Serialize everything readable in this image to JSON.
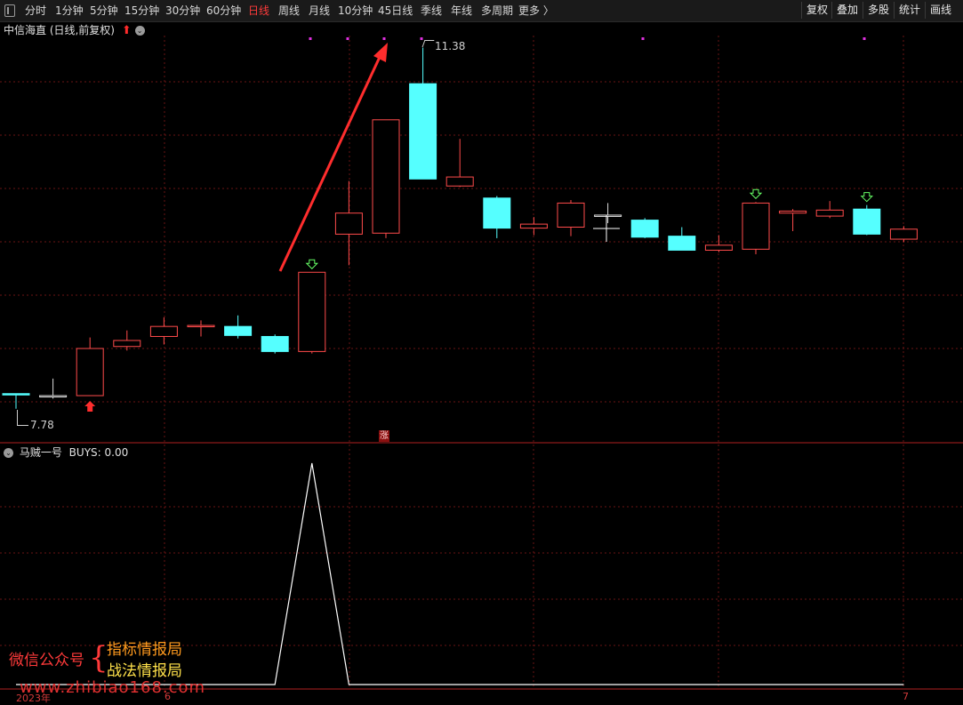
{
  "toolbar": {
    "periods": [
      "分时",
      "1分钟",
      "5分钟",
      "15分钟",
      "30分钟",
      "60分钟",
      "日线",
      "周线",
      "月线",
      "10分钟",
      "45日线",
      "季线",
      "年线",
      "多周期",
      "更多 〉"
    ],
    "active_period": "日线",
    "right_buttons": [
      "复权",
      "叠加",
      "多股",
      "统计",
      "画线"
    ]
  },
  "main_chart": {
    "title": "中信海直 (日线,前复权)",
    "high_label": "11.38",
    "low_label": "7.78",
    "limit_up_marker": "涨"
  },
  "indicator": {
    "title": "马贼一号",
    "value_label": "BUYS: 0.00"
  },
  "date_axis": {
    "year_label": "2023年",
    "month_6": "6",
    "month_7": "7"
  },
  "watermark": {
    "left": "微信公众号",
    "brace": "{",
    "right_1": "指标情报局",
    "right_2": "战法情报局",
    "url": "www.zhibiao168.com"
  },
  "colors": {
    "up": "#ff4b4b",
    "down": "#55ffff",
    "active_tab": "#ff3b3b",
    "grid": "#6a1414",
    "buy_arrow": "#66ff66"
  },
  "chart_data": {
    "type": "candlestick",
    "price_range": [
      7.6,
      11.5
    ],
    "candles": [
      {
        "open": 7.93,
        "close": 7.93,
        "high": 7.93,
        "low": 7.78,
        "dir": "down"
      },
      {
        "open": 7.91,
        "close": 7.91,
        "high": 8.08,
        "low": 7.88,
        "dir": "flat"
      },
      {
        "open": 7.91,
        "close": 8.38,
        "high": 8.49,
        "low": 7.91,
        "dir": "up"
      },
      {
        "open": 8.4,
        "close": 8.46,
        "high": 8.56,
        "low": 8.36,
        "dir": "up"
      },
      {
        "open": 8.5,
        "close": 8.6,
        "high": 8.69,
        "low": 8.42,
        "dir": "up"
      },
      {
        "open": 8.6,
        "close": 8.61,
        "high": 8.66,
        "low": 8.5,
        "dir": "up"
      },
      {
        "open": 8.6,
        "close": 8.51,
        "high": 8.71,
        "low": 8.48,
        "dir": "down"
      },
      {
        "open": 8.5,
        "close": 8.35,
        "high": 8.52,
        "low": 8.33,
        "dir": "down"
      },
      {
        "open": 8.35,
        "close": 9.14,
        "high": 9.14,
        "low": 8.33,
        "dir": "up",
        "buy_signal": true
      },
      {
        "open": 9.52,
        "close": 9.73,
        "high": 10.05,
        "low": 9.21,
        "dir": "up"
      },
      {
        "open": 9.53,
        "close": 10.66,
        "high": 10.66,
        "low": 9.48,
        "dir": "up"
      },
      {
        "open": 11.02,
        "close": 10.07,
        "high": 11.38,
        "low": 10.07,
        "dir": "down"
      },
      {
        "open": 10.0,
        "close": 10.09,
        "high": 10.47,
        "low": 9.99,
        "dir": "up"
      },
      {
        "open": 9.88,
        "close": 9.58,
        "high": 9.9,
        "low": 9.48,
        "dir": "down"
      },
      {
        "open": 9.58,
        "close": 9.62,
        "high": 9.69,
        "low": 9.51,
        "dir": "up"
      },
      {
        "open": 9.59,
        "close": 9.83,
        "high": 9.86,
        "low": 9.5,
        "dir": "up"
      },
      {
        "open": 9.71,
        "close": 9.71,
        "high": 9.83,
        "low": 9.63,
        "dir": "flat"
      },
      {
        "open": 9.66,
        "close": 9.49,
        "high": 9.68,
        "low": 9.48,
        "dir": "down"
      },
      {
        "open": 9.5,
        "close": 9.36,
        "high": 9.59,
        "low": 9.36,
        "dir": "down"
      },
      {
        "open": 9.36,
        "close": 9.41,
        "high": 9.51,
        "low": 9.34,
        "dir": "up"
      },
      {
        "open": 9.37,
        "close": 9.83,
        "high": 9.84,
        "low": 9.32,
        "dir": "up",
        "buy_signal": true
      },
      {
        "open": 9.73,
        "close": 9.75,
        "high": 9.77,
        "low": 9.55,
        "dir": "up"
      },
      {
        "open": 9.7,
        "close": 9.76,
        "high": 9.85,
        "low": 9.68,
        "dir": "up"
      },
      {
        "open": 9.77,
        "close": 9.52,
        "high": 9.81,
        "low": 9.51,
        "dir": "down",
        "buy_signal": true
      },
      {
        "open": 9.47,
        "close": 9.57,
        "high": 9.6,
        "low": 9.44,
        "dir": "up"
      }
    ],
    "indicator_series": {
      "name": "BUYS",
      "values": [
        0,
        0,
        0,
        0,
        0,
        0,
        0,
        0,
        1,
        0,
        0,
        0,
        0,
        0,
        0,
        0,
        0,
        0,
        0,
        0,
        0,
        0,
        0,
        0,
        0
      ]
    }
  }
}
